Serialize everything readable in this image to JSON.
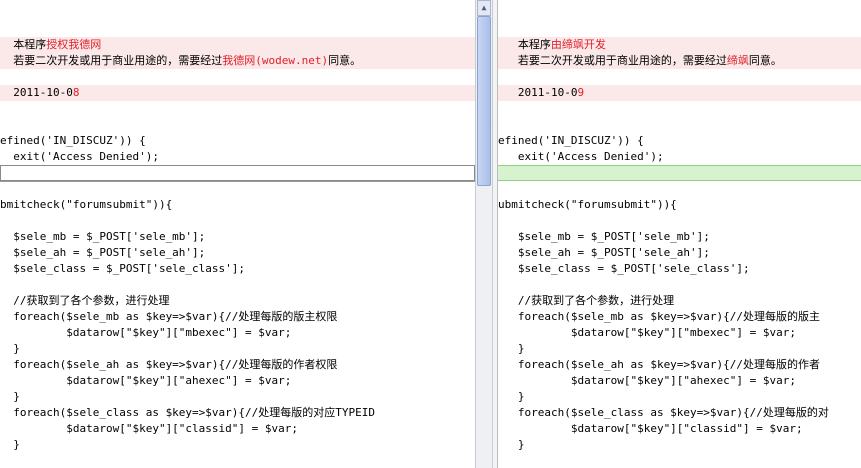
{
  "left": {
    "header1_prefix": "  本程序",
    "header1_red": "授权我德网",
    "header2_prefix": "  若要二次开发或用于商业用途的，需要经过",
    "header2_red": "我德网(wodew.net)",
    "header2_suffix": "同意。",
    "date_prefix": "  2011-10-0",
    "date_red": "8",
    "code": [
      "efined('IN_DISCUZ')) {",
      "  exit('Access Denied');",
      "",
      "",
      "bmitcheck(\"forumsubmit\")){",
      "",
      "  $sele_mb = $_POST['sele_mb'];",
      "  $sele_ah = $_POST['sele_ah'];",
      "  $sele_class = $_POST['sele_class'];",
      "",
      "  //获取到了各个参数，进行处理",
      "  foreach($sele_mb as $key=>$var){//处理每版的版主权限",
      "          $datarow[\"$key\"][\"mbexec\"] = $var;",
      "  }",
      "  foreach($sele_ah as $key=>$var){//处理每版的作者权限",
      "          $datarow[\"$key\"][\"ahexec\"] = $var;",
      "  }",
      "  foreach($sele_class as $key=>$var){//处理每版的对应TYPEID",
      "          $datarow[\"$key\"][\"classid\"] = $var;",
      "  }"
    ]
  },
  "right": {
    "header1_prefix": "   本程序",
    "header1_red": "由缔飒开发",
    "header2_prefix": "   若要二次开发或用于商业用途的，需要经过",
    "header2_red": "缔飒",
    "header2_suffix": "同意。",
    "date_prefix": "   2011-10-0",
    "date_red": "9",
    "code": [
      "efined('IN_DISCUZ')) {",
      "   exit('Access Denied');",
      "",
      "",
      "ubmitcheck(\"forumsubmit\")){",
      "",
      "   $sele_mb = $_POST['sele_mb'];",
      "   $sele_ah = $_POST['sele_ah'];",
      "   $sele_class = $_POST['sele_class'];",
      "",
      "   //获取到了各个参数，进行处理",
      "   foreach($sele_mb as $key=>$var){//处理每版的版主",
      "           $datarow[\"$key\"][\"mbexec\"] = $var;",
      "   }",
      "   foreach($sele_ah as $key=>$var){//处理每版的作者",
      "           $datarow[\"$key\"][\"ahexec\"] = $var;",
      "   }",
      "   foreach($sele_class as $key=>$var){//处理每版的对",
      "           $datarow[\"$key\"][\"classid\"] = $var;",
      "   }"
    ]
  },
  "scrollbar": {
    "up_arrow": "▲"
  },
  "colors": {
    "diff_bg": "#fbe9e9",
    "added_bg": "#d6f2cf",
    "highlight": "#e0202a"
  }
}
